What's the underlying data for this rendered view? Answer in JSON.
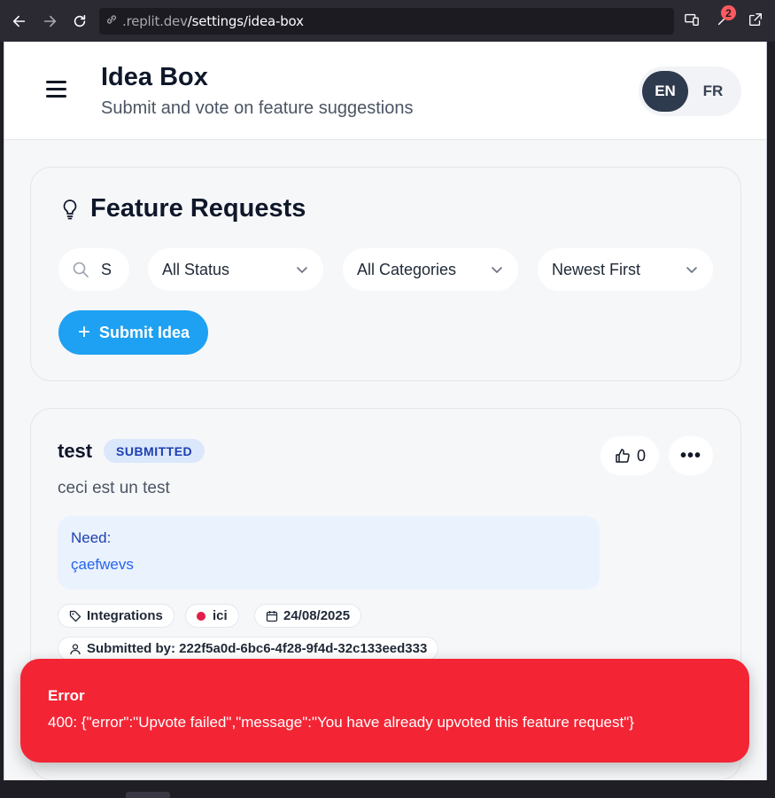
{
  "browser": {
    "url_host": ".replit.dev",
    "url_path": "/settings/idea-box",
    "extensions_badge": "2"
  },
  "header": {
    "title": "Idea Box",
    "subtitle": "Submit and vote on feature suggestions",
    "languages": [
      "EN",
      "FR"
    ],
    "active_language": "EN"
  },
  "filters": {
    "section_title": "Feature Requests",
    "search_value": "S",
    "status_select": "All Status",
    "category_select": "All Categories",
    "sort_select": "Newest First",
    "submit_label": "Submit Idea"
  },
  "request": {
    "title": "test",
    "status": "SUBMITTED",
    "votes": "0",
    "description": "ceci est un test",
    "need_label": "Need:",
    "need_value": "çaefwevs",
    "category": "Integrations",
    "location": "ici",
    "date": "24/08/2025",
    "submitted_by": "Submitted by: 222f5a0d-6bc6-4f28-9f4d-32c133eed333"
  },
  "toast": {
    "title": "Error",
    "message": "400: {\"error\":\"Upvote failed\",\"message\":\"You have already upvoted this feature request\"}",
    "color": "#f32535"
  },
  "colors": {
    "accent": "#1ea1f2",
    "status_bg": "#dbe7fb",
    "status_text": "#1e40af"
  }
}
